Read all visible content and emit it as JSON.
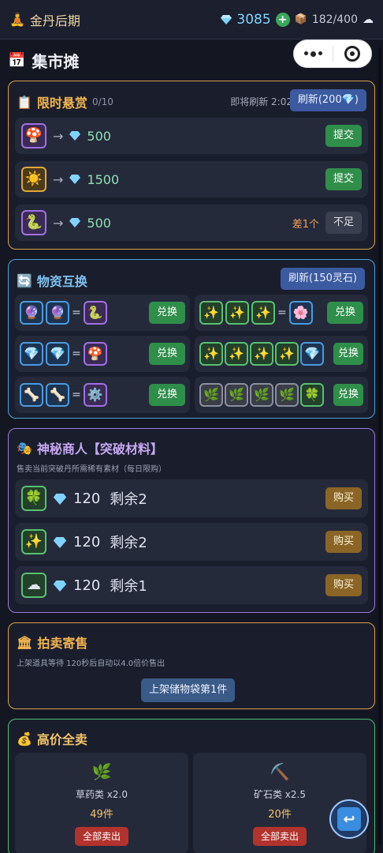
{
  "topbar": {
    "realm_icon": "meditating-person-icon",
    "realm": "金丹后期",
    "spirit_stones": "3085",
    "add_label": "+",
    "bag": "182/400",
    "bag_icon": "box-icon",
    "cloud_icon": "cloud-icon"
  },
  "page": {
    "title": "集市摊",
    "title_icon": "calendar-icon"
  },
  "bounty": {
    "title": "限时悬赏",
    "progress": "0/10",
    "refresh_timer": "即将刷新 2:02",
    "refresh_button": "刷新(200💎)",
    "rows": [
      {
        "item_icon": "mushroom-icon",
        "price": "500",
        "action": "提交",
        "shortage": ""
      },
      {
        "item_icon": "sun-icon",
        "price": "1500",
        "action": "提交",
        "shortage": ""
      },
      {
        "item_icon": "snake-icon",
        "price": "500",
        "action": "不足",
        "shortage": "差1个"
      }
    ]
  },
  "exchange": {
    "title": "物资互换",
    "refresh_button": "刷新(150灵石)",
    "rows": [
      {
        "left_icons": [
          "crystal-ball-icon",
          "crystal-ball-icon"
        ],
        "left_result": "snake-icon",
        "left_action": "兑换",
        "right_icons": [
          "sparkles-icon",
          "sparkles-icon",
          "sparkles-icon"
        ],
        "right_result": "cherry-blossom-icon",
        "right_action": "兑换"
      },
      {
        "left_icons": [
          "gem-icon",
          "gem-icon"
        ],
        "left_result": "mushroom-icon",
        "left_action": "兑换",
        "right_icons": [
          "sparkles-icon",
          "sparkles-icon",
          "sparkles-icon",
          "sparkles-icon"
        ],
        "right_result": "gem-icon",
        "right_action": "兑换"
      },
      {
        "left_icons": [
          "bone-icon",
          "bone-icon"
        ],
        "left_result": "gear-icon",
        "left_action": "兑换",
        "right_icons": [
          "herb-icon",
          "herb-icon",
          "herb-icon",
          "herb-icon"
        ],
        "right_result": "four-leaf-clover-icon",
        "right_action": "兑换"
      }
    ],
    "eq": "="
  },
  "merchant": {
    "title": "神秘商人【突破材料】",
    "desc": "售卖当前突破丹所需稀有素材（每日限购）",
    "rows": [
      {
        "item_icon": "four-leaf-clover-icon",
        "price": "120",
        "stock": "剩余2",
        "action": "购买"
      },
      {
        "item_icon": "sparkles-icon",
        "price": "120",
        "stock": "剩余2",
        "action": "购买"
      },
      {
        "item_icon": "cloud-icon",
        "price": "120",
        "stock": "剩余1",
        "action": "购买"
      }
    ]
  },
  "auction": {
    "title": "拍卖寄售",
    "desc": "上架道具等待 120秒后自动以4.0倍价售出",
    "button": "上架储物袋第1件"
  },
  "sell_all": {
    "title": "高价全卖",
    "cards": [
      {
        "icon": "herb-icon",
        "name": "草药类 x2.0",
        "count": "49件",
        "action": "全部卖出"
      },
      {
        "icon": "pickaxe-icon",
        "name": "矿石类 x2.5",
        "count": "20件",
        "action": "全部卖出"
      }
    ]
  },
  "float_button_icon": "return-arrow-icon"
}
